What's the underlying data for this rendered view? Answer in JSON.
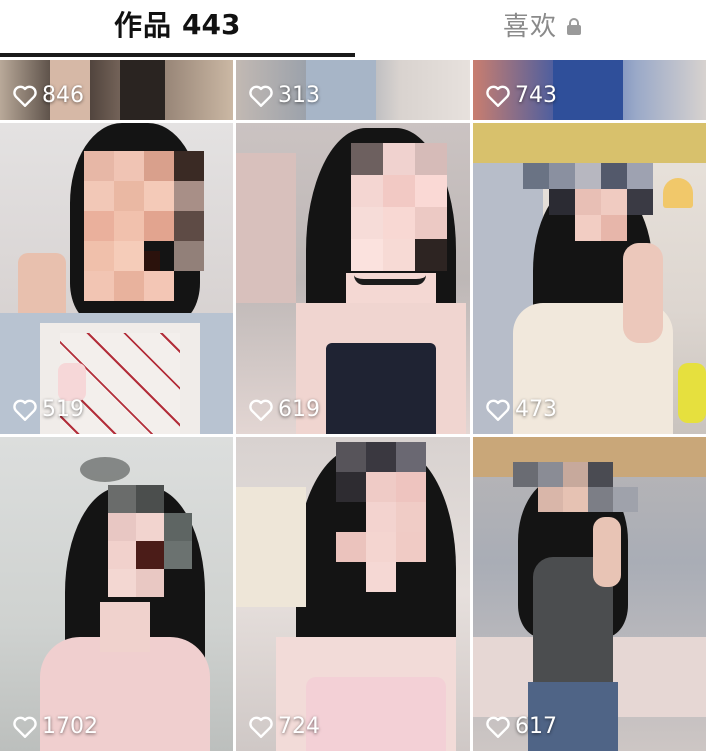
{
  "tabs": {
    "works": {
      "label": "作品",
      "count": "443"
    },
    "likes": {
      "label": "喜欢",
      "locked": true,
      "lock_icon": "lock-icon"
    }
  },
  "colors": {
    "active_tab": "#111111",
    "inactive_tab": "#8a8a8a",
    "underline": "#1a1a1a"
  },
  "videos": [
    {
      "likes": "846"
    },
    {
      "likes": "313"
    },
    {
      "likes": "743"
    },
    {
      "likes": "519"
    },
    {
      "likes": "619"
    },
    {
      "likes": "473"
    },
    {
      "likes": "1702"
    },
    {
      "likes": "724"
    },
    {
      "likes": "617"
    }
  ]
}
